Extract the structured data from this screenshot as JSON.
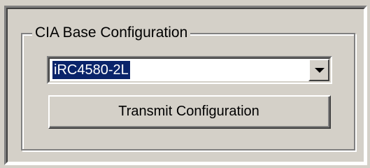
{
  "group": {
    "title": "CIA Base Configuration"
  },
  "combo": {
    "selected_value": "iRC4580-2L",
    "arrow_icon": "chevron-down-icon"
  },
  "actions": {
    "transmit_label": "Transmit Configuration"
  },
  "colors": {
    "face": "#d4d0c8",
    "selection": "#0a246a"
  }
}
